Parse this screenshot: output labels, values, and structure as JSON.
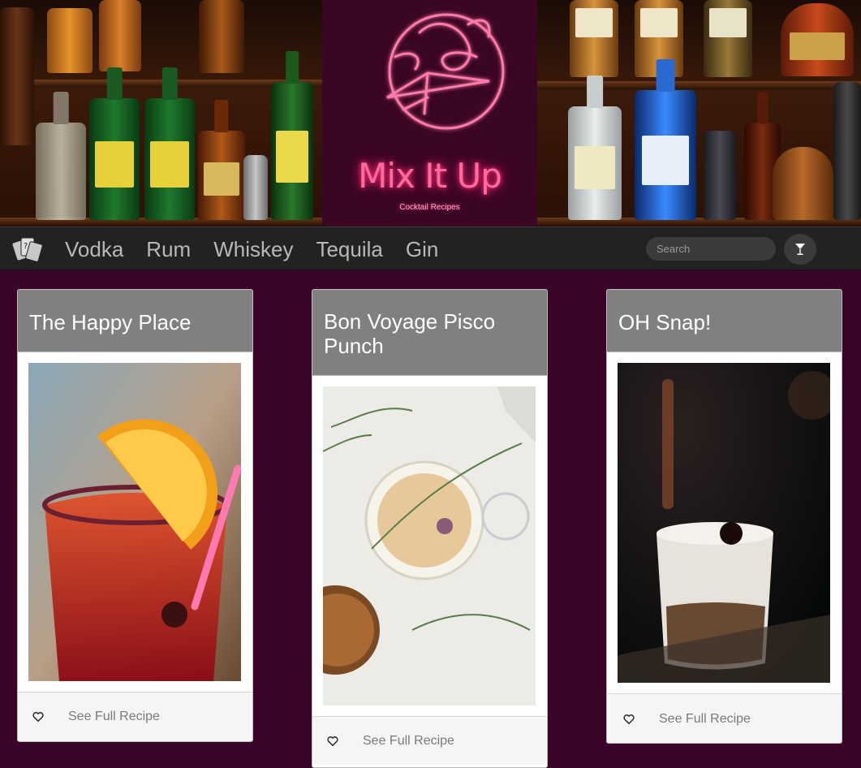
{
  "header": {
    "brand_title": "Mix It Up",
    "brand_subtitle": "Cocktail Recipes",
    "colors": {
      "neon": "#ff2a75",
      "panel": "#3b0524"
    }
  },
  "nav": {
    "logo_icon": "playing-cards-icon",
    "links": [
      "Vodka",
      "Rum",
      "Whiskey",
      "Tequila",
      "Gin"
    ],
    "search_placeholder": "Search",
    "search_icon": "cocktail-glass-icon"
  },
  "cards": [
    {
      "title": "The Happy Place",
      "link": "See Full Recipe",
      "icon": "heart-icon"
    },
    {
      "title": "Bon Voyage Pisco Punch",
      "link": "See Full Recipe",
      "icon": "heart-icon"
    },
    {
      "title": "OH Snap!",
      "link": "See Full Recipe",
      "icon": "heart-icon"
    }
  ],
  "colors": {
    "page_bg": "#3a0428",
    "nav_bg": "#222222",
    "card_header": "#808080"
  }
}
